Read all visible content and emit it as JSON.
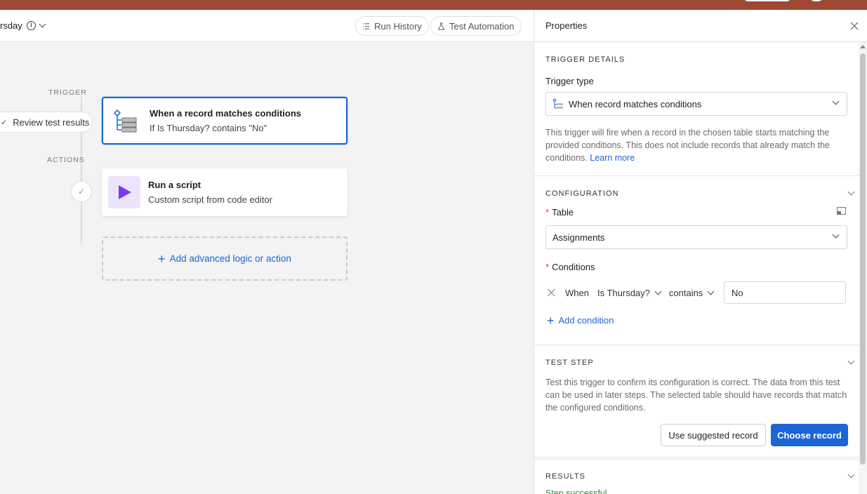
{
  "toolbar": {
    "automation_name": "rsday",
    "run_history_label": "Run History",
    "test_automation_label": "Test Automation"
  },
  "canvas": {
    "trigger_label": "TRIGGER",
    "actions_label": "ACTIONS",
    "review_label": "Review test results",
    "trigger_card": {
      "title": "When a record matches conditions",
      "subtitle": "If Is Thursday? contains \"No\""
    },
    "action_card": {
      "title": "Run a script",
      "subtitle": "Custom script from code editor"
    },
    "add_label": "Add advanced logic or action"
  },
  "panel": {
    "title": "Properties",
    "trigger_details": {
      "heading": "TRIGGER DETAILS",
      "type_label": "Trigger type",
      "type_value": "When record matches conditions",
      "description": "This trigger will fire when a record in the chosen table starts matching the provided conditions. This does not include records that already match the conditions.",
      "learn_more": "Learn more"
    },
    "configuration": {
      "heading": "CONFIGURATION",
      "table_label": "Table",
      "table_value": "Assignments",
      "conditions_label": "Conditions",
      "condition": {
        "when": "When",
        "field": "Is Thursday?",
        "operator": "contains",
        "value": "No"
      },
      "add_condition": "Add condition"
    },
    "test_step": {
      "heading": "TEST STEP",
      "description": "Test this trigger to confirm its configuration is correct. The data from this test can be used in later steps. The selected table should have records that match the configured conditions.",
      "suggested_button": "Use suggested record",
      "choose_button": "Choose record"
    },
    "results": {
      "heading": "RESULTS",
      "status": "Step successful"
    }
  },
  "colors": {
    "accent": "#1b66d6",
    "topbar": "#a04836",
    "script_icon": "#7c3aed",
    "success": "#2a8a3a"
  }
}
